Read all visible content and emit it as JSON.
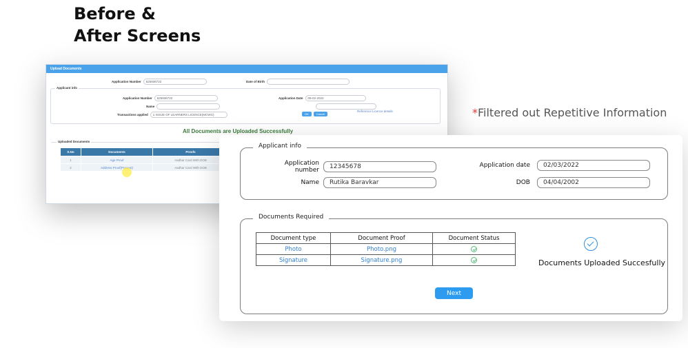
{
  "heading": {
    "line1": "Before &",
    "line2": "After Screens"
  },
  "annotation": {
    "star": "*",
    "text": "Filtered out Repetitive Information"
  },
  "old_screen": {
    "title": "Upload Documents",
    "app_number_label": "Application Number",
    "app_number_value": "525936722",
    "dob_label": "Date of Birth",
    "group_title": "Applicant info",
    "inner_app_number_label": "Application Number",
    "inner_app_number_value": "525936722",
    "app_date_label": "Application Date",
    "app_date_value": "09-02-2022",
    "name_label": "Name",
    "transactions_label": "Transactions applied",
    "transactions_value": "1 ISSUE OF LEARNERS LICENCE(MCWG)",
    "ok_label": "OK",
    "cancel_label": "Cancel",
    "ref_link": "Reference Licence details",
    "success": "All Documents are Uploaded Successfully",
    "uploaded_title": "Uploaded Documents",
    "table_headers": [
      "S.No",
      "Documents",
      "Proofs"
    ],
    "table_rows": [
      [
        "1",
        "Age Proof",
        "Aadhar Card With DOB"
      ],
      [
        "2",
        "Address Proof(Present)",
        "Aadhar Card With DOB"
      ]
    ]
  },
  "new_screen": {
    "applicant_title": "Applicant info",
    "app_number_label": "Application number",
    "app_number_value": "12345678",
    "app_date_label": "Application date",
    "app_date_value": "02/03/2022",
    "name_label": "Name",
    "name_value": "Rutika Baravkar",
    "dob_label": "DOB",
    "dob_value": "04/04/2002",
    "docs_title": "Documents Required",
    "table_headers": [
      "Document type",
      "Document Proof",
      "Document Status"
    ],
    "table_rows": [
      {
        "type": "Photo",
        "proof": "Photo.png"
      },
      {
        "type": "Signature",
        "proof": "Signature.png"
      }
    ],
    "uploaded_text": "Documents Uploaded Succesfully",
    "next_label": "Next"
  }
}
